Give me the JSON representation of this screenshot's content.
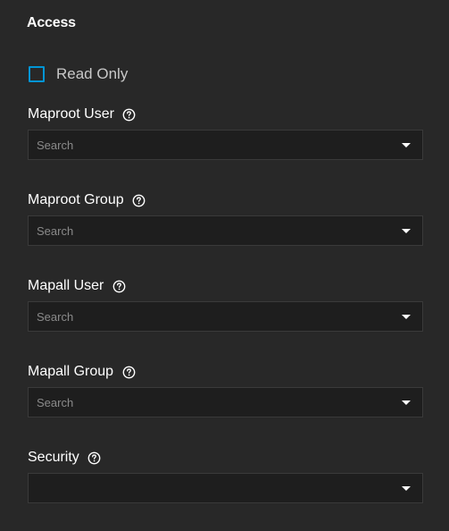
{
  "section": {
    "title": "Access"
  },
  "read_only": {
    "label": "Read Only",
    "checked": false
  },
  "fields": [
    {
      "label": "Maproot User",
      "placeholder": "Search",
      "value": ""
    },
    {
      "label": "Maproot Group",
      "placeholder": "Search",
      "value": ""
    },
    {
      "label": "Mapall User",
      "placeholder": "Search",
      "value": ""
    },
    {
      "label": "Mapall Group",
      "placeholder": "Search",
      "value": ""
    },
    {
      "label": "Security",
      "placeholder": "",
      "value": ""
    }
  ],
  "icons": {
    "help": "help-circle-icon",
    "dropdown": "chevron-down-icon"
  },
  "colors": {
    "background": "#282828",
    "input_background": "#1e1e1e",
    "checkbox_border": "#0095d5",
    "label_text": "#ffffff",
    "placeholder_text": "#8a8a8a"
  }
}
